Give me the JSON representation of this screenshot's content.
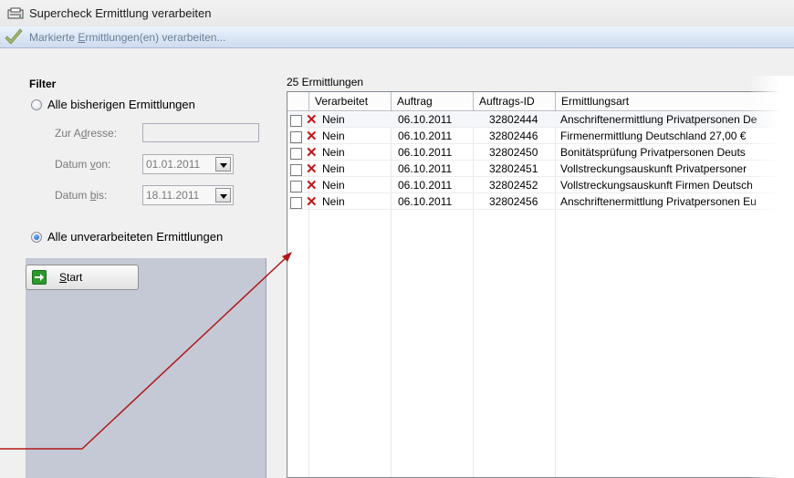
{
  "window": {
    "title": "Supercheck Ermittlung verarbeiten",
    "icon": "window-app-icon"
  },
  "toolbar": {
    "icon": "checkmark-icon",
    "label_pre": "Markierte ",
    "label_accel": "E",
    "label_post": "rmittlungen(en) verarbeiten..."
  },
  "filter": {
    "title": "Filter",
    "option_all": "Alle bisherigen Ermittlungen",
    "address_label": "Zur Adresse:",
    "date_from_label": "Datum von:",
    "date_from_value": "01.01.2011",
    "date_to_label": "Datum bis:",
    "date_to_value": "18.11.2011",
    "option_unprocessed": "Alle unverarbeiteten Ermittlungen",
    "selected_option": "Alle unverarbeiteten Ermittlungen"
  },
  "start_button": {
    "accel": "S",
    "rest": "tart",
    "icon": "arrow-right-icon"
  },
  "list": {
    "count_label": "25 Ermittlungen",
    "columns": [
      "Verarbeitet",
      "Auftrag",
      "Auftrags-ID",
      "Ermittlungsart"
    ],
    "rows": [
      {
        "verarbeitet": "Nein",
        "auftrag": "06.10.2011",
        "auftrags_id": "32802444",
        "ermittlungsart": "Anschriftenermittlung Privatpersonen De"
      },
      {
        "verarbeitet": "Nein",
        "auftrag": "06.10.2011",
        "auftrags_id": "32802446",
        "ermittlungsart": "Firmenermittlung Deutschland 27,00 €"
      },
      {
        "verarbeitet": "Nein",
        "auftrag": "06.10.2011",
        "auftrags_id": "32802450",
        "ermittlungsart": "Bonitätsprüfung Privatpersonen Deuts"
      },
      {
        "verarbeitet": "Nein",
        "auftrag": "06.10.2011",
        "auftrags_id": "32802451",
        "ermittlungsart": "Vollstreckungsauskunft Privatpersoner"
      },
      {
        "verarbeitet": "Nein",
        "auftrag": "06.10.2011",
        "auftrags_id": "32802452",
        "ermittlungsart": "Vollstreckungsauskunft Firmen Deutsch"
      },
      {
        "verarbeitet": "Nein",
        "auftrag": "06.10.2011",
        "auftrags_id": "32802456",
        "ermittlungsart": "Anschriftenermittlung Privatpersonen Eu"
      }
    ]
  },
  "colors": {
    "callout_line": "#b01818",
    "reject_mark": "#c01818",
    "toolbar_text": "#6a7f98"
  }
}
